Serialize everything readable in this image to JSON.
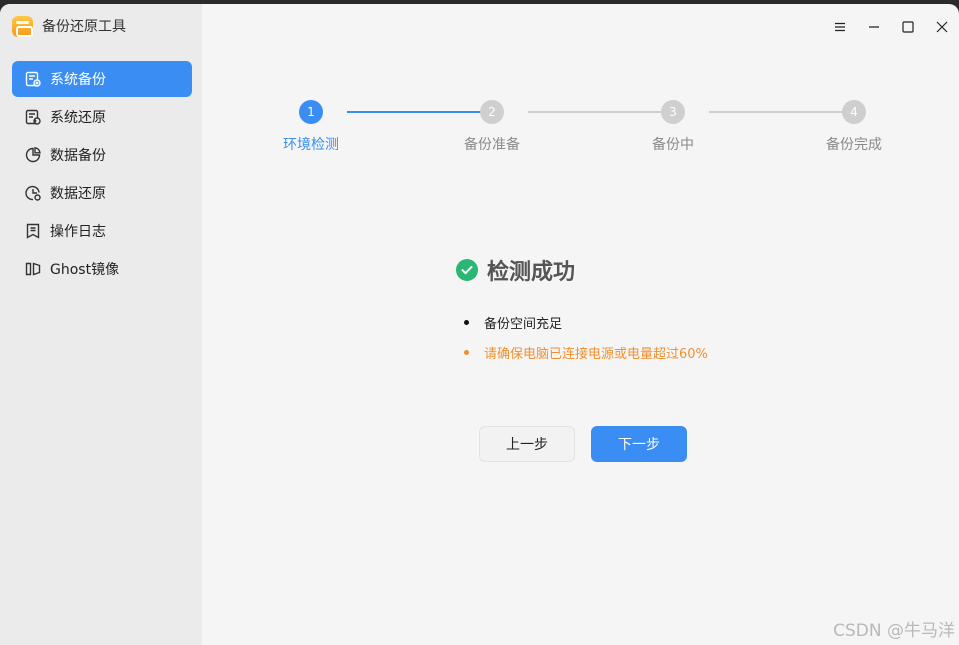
{
  "app": {
    "title": "备份还原工具"
  },
  "sidebar": {
    "items": [
      {
        "label": "系统备份",
        "icon": "system-backup-icon",
        "active": true
      },
      {
        "label": "系统还原",
        "icon": "system-restore-icon",
        "active": false
      },
      {
        "label": "数据备份",
        "icon": "data-backup-icon",
        "active": false
      },
      {
        "label": "数据还原",
        "icon": "data-restore-icon",
        "active": false
      },
      {
        "label": "操作日志",
        "icon": "operation-log-icon",
        "active": false
      },
      {
        "label": "Ghost镜像",
        "icon": "ghost-image-icon",
        "active": false
      }
    ]
  },
  "titlebar": {
    "controls": [
      "menu-icon",
      "minimize-icon",
      "maximize-icon",
      "close-icon"
    ]
  },
  "stepper": {
    "steps": [
      {
        "number": "1",
        "label": "环境检测",
        "active": true
      },
      {
        "number": "2",
        "label": "备份准备",
        "active": false
      },
      {
        "number": "3",
        "label": "备份中",
        "active": false
      },
      {
        "number": "4",
        "label": "备份完成",
        "active": false
      }
    ]
  },
  "result": {
    "title": "检测成功",
    "icon": "success-check-icon"
  },
  "checks": [
    {
      "text": "备份空间充足",
      "status": "ok"
    },
    {
      "text": "请确保电脑已连接电源或电量超过60%",
      "status": "warning"
    }
  ],
  "buttons": {
    "prev": "上一步",
    "next": "下一步"
  },
  "watermark": "CSDN @牛马洋",
  "colors": {
    "accent": "#3a8df3",
    "success": "#2bb673",
    "warning": "#f0902e"
  }
}
